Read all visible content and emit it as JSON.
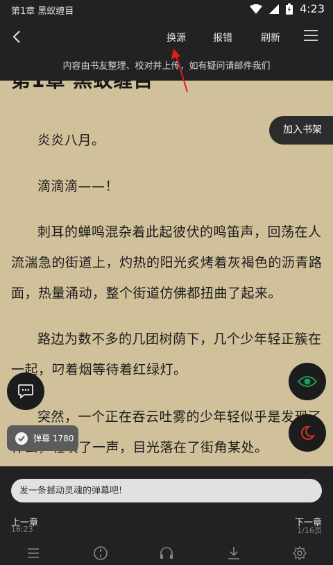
{
  "status": {
    "left_text": "第1章 黑蚁缠目",
    "time": "4:23"
  },
  "toolbar": {
    "change_source": "换源",
    "report": "报错",
    "refresh": "刷新",
    "notice": "内容由书友整理、校对并上传，如有疑问请邮件我们"
  },
  "chapter": {
    "title": "第1章 黑蚁缠目",
    "paragraphs": [
      "炎炎八月。",
      "滴滴滴——！",
      "刺耳的蝉鸣混杂着此起彼伏的鸣笛声，回荡在人流湍急的街道上，灼热的阳光炙烤着灰褐色的沥青路面，热量涌动，整个街道仿佛都扭曲了起来。",
      "路边为数不多的几团树荫下，几个少年轻正簇在一起，叼着烟等待着红绿灯。",
      "突然，一个正在吞云吐雾的少年轻似乎是发现了什么，轻咦了一声，目光落在了街角某处。"
    ]
  },
  "add_to_shelf": "加入书架",
  "danmu": {
    "label": "弹幕 1780"
  },
  "bottom": {
    "comment_placeholder": "发一条撼动灵魂的弹幕吧!",
    "prev_chapter": "上一章",
    "next_chapter": "下一章",
    "time": "16:23",
    "page": "1/16页"
  },
  "icons": [
    "back-icon",
    "menu-icon",
    "chat-icon",
    "eye-icon",
    "moon-icon",
    "check-icon",
    "list-icon",
    "progress-icon",
    "headphones-icon",
    "download-icon",
    "settings-icon",
    "wifi-icon",
    "signal-icon",
    "battery-icon"
  ],
  "colors": {
    "paper": "#d1c19b",
    "bar": "#222222",
    "eye": "#1f9b5d",
    "moon": "#d9342b",
    "arrow": "#e01c1c"
  }
}
